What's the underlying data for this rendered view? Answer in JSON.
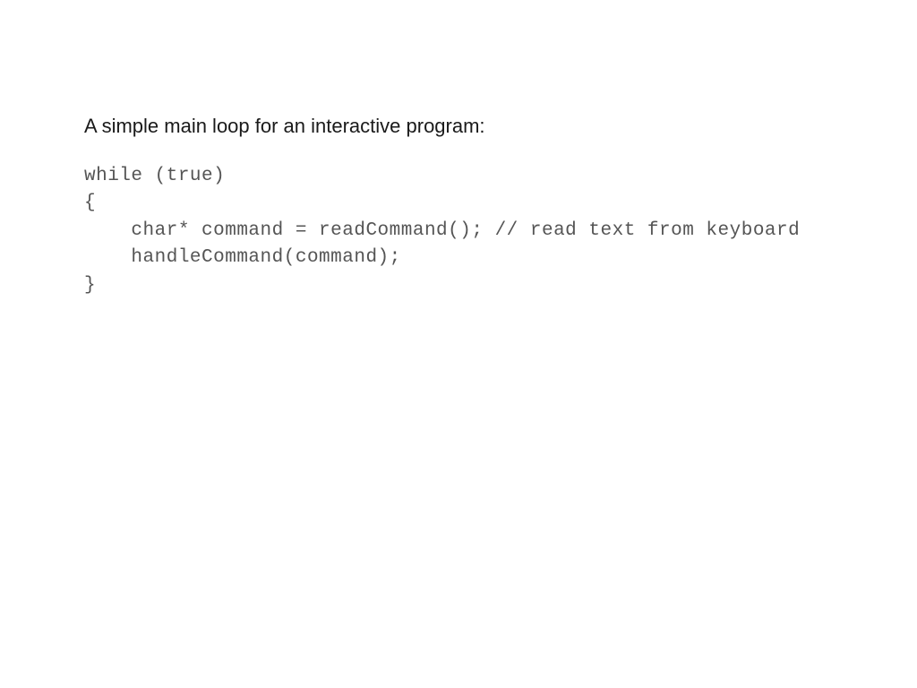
{
  "slide": {
    "heading": "A simple main loop for an interactive program:",
    "code": "while (true)\n{\n    char* command = readCommand(); // read text from keyboard\n    handleCommand(command);\n}"
  }
}
